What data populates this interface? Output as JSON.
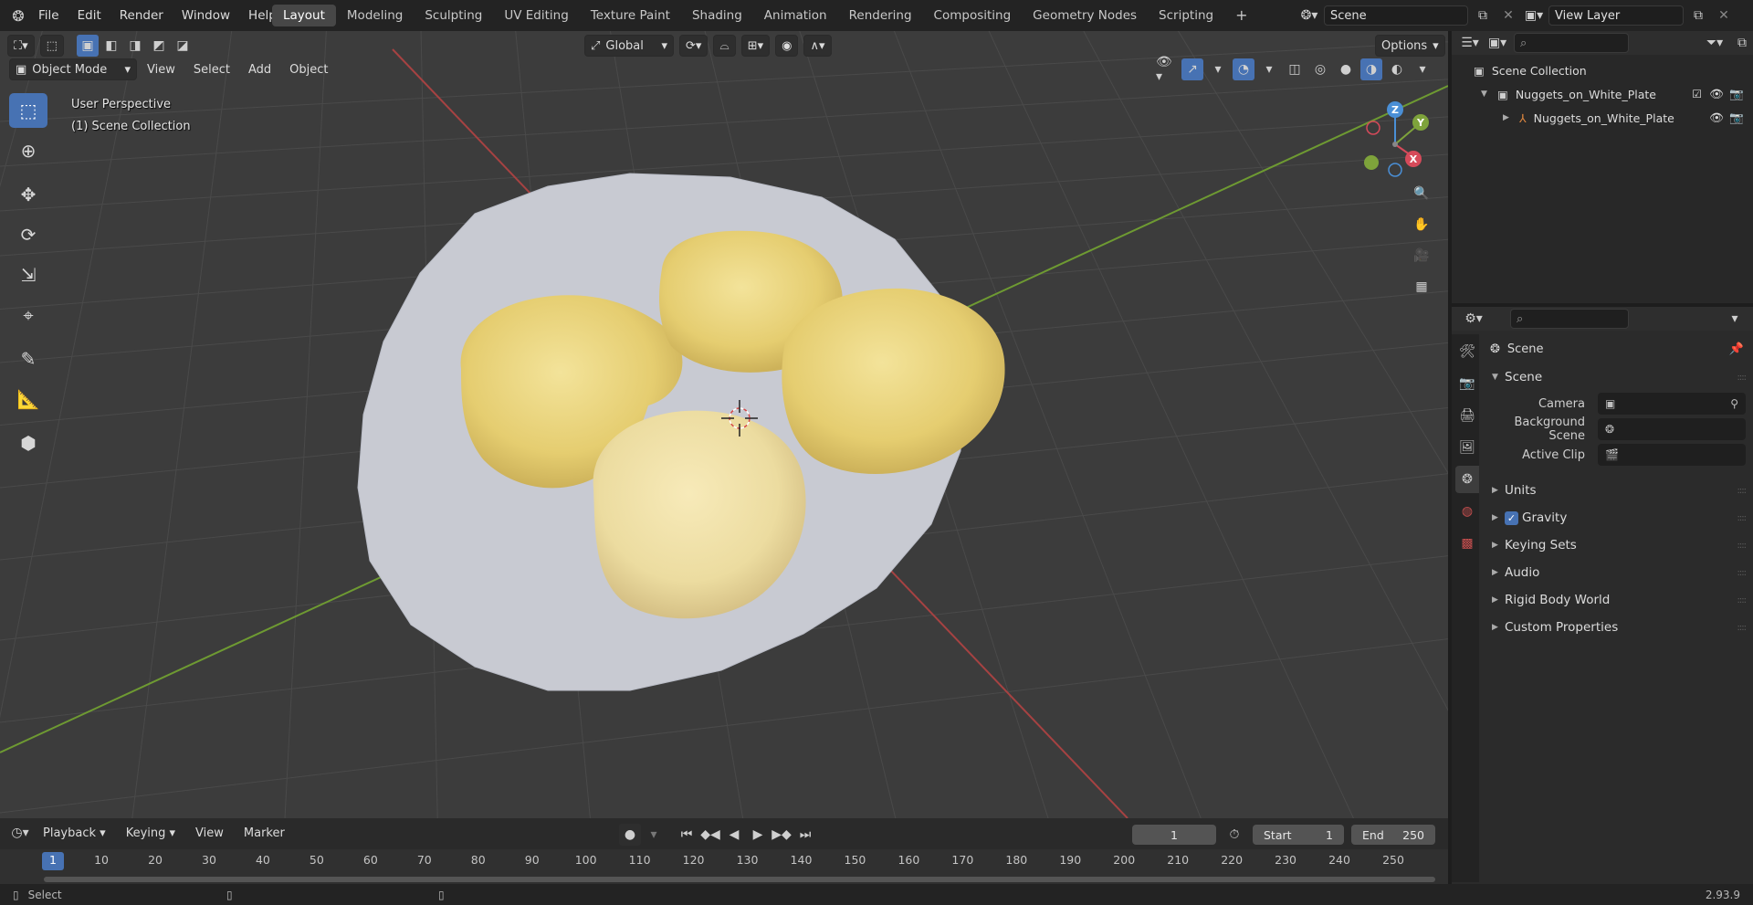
{
  "topbar": {
    "menus": [
      "File",
      "Edit",
      "Render",
      "Window",
      "Help"
    ],
    "workspaces": [
      "Layout",
      "Modeling",
      "Sculpting",
      "UV Editing",
      "Texture Paint",
      "Shading",
      "Animation",
      "Rendering",
      "Compositing",
      "Geometry Nodes",
      "Scripting"
    ],
    "active_workspace": "Layout",
    "add_workspace": "+",
    "scene_name": "Scene",
    "view_layer": "View Layer"
  },
  "viewport": {
    "mode": "Object Mode",
    "menus": [
      "View",
      "Select",
      "Add",
      "Object"
    ],
    "orientation": "Global",
    "options_label": "Options",
    "overlay_line1": "User Perspective",
    "overlay_line2": "(1) Scene Collection",
    "gizmo": {
      "z": "Z",
      "y": "Y",
      "x": "X"
    }
  },
  "outliner": {
    "root": "Scene Collection",
    "items": [
      {
        "label": "Nuggets_on_White_Plate",
        "type": "collection"
      },
      {
        "label": "Nuggets_on_White_Plate",
        "type": "object"
      }
    ]
  },
  "properties": {
    "context": "Scene",
    "section": "Scene",
    "fields": [
      {
        "label": "Camera"
      },
      {
        "label": "Background Scene"
      },
      {
        "label": "Active Clip"
      }
    ],
    "panels": [
      "Units",
      "Gravity",
      "Keying Sets",
      "Audio",
      "Rigid Body World",
      "Custom Properties"
    ],
    "gravity_checked": true
  },
  "timeline": {
    "menus": [
      "Playback",
      "Keying",
      "View",
      "Marker"
    ],
    "current_frame": "1",
    "start_label": "Start",
    "start": "1",
    "end_label": "End",
    "end": "250",
    "ticks": [
      "1",
      "10",
      "20",
      "30",
      "40",
      "50",
      "60",
      "70",
      "80",
      "90",
      "100",
      "110",
      "120",
      "130",
      "140",
      "150",
      "160",
      "170",
      "180",
      "190",
      "200",
      "210",
      "220",
      "230",
      "240",
      "250"
    ]
  },
  "status": {
    "select_label": "Select",
    "version": "2.93.9"
  },
  "colors": {
    "accent": "#4772b3",
    "x_axis": "#b84a4a",
    "y_axis": "#7ea33b",
    "z_axis": "#4a8fd6",
    "plate": "#c9cbd3",
    "nugget": "#e9d47f"
  }
}
